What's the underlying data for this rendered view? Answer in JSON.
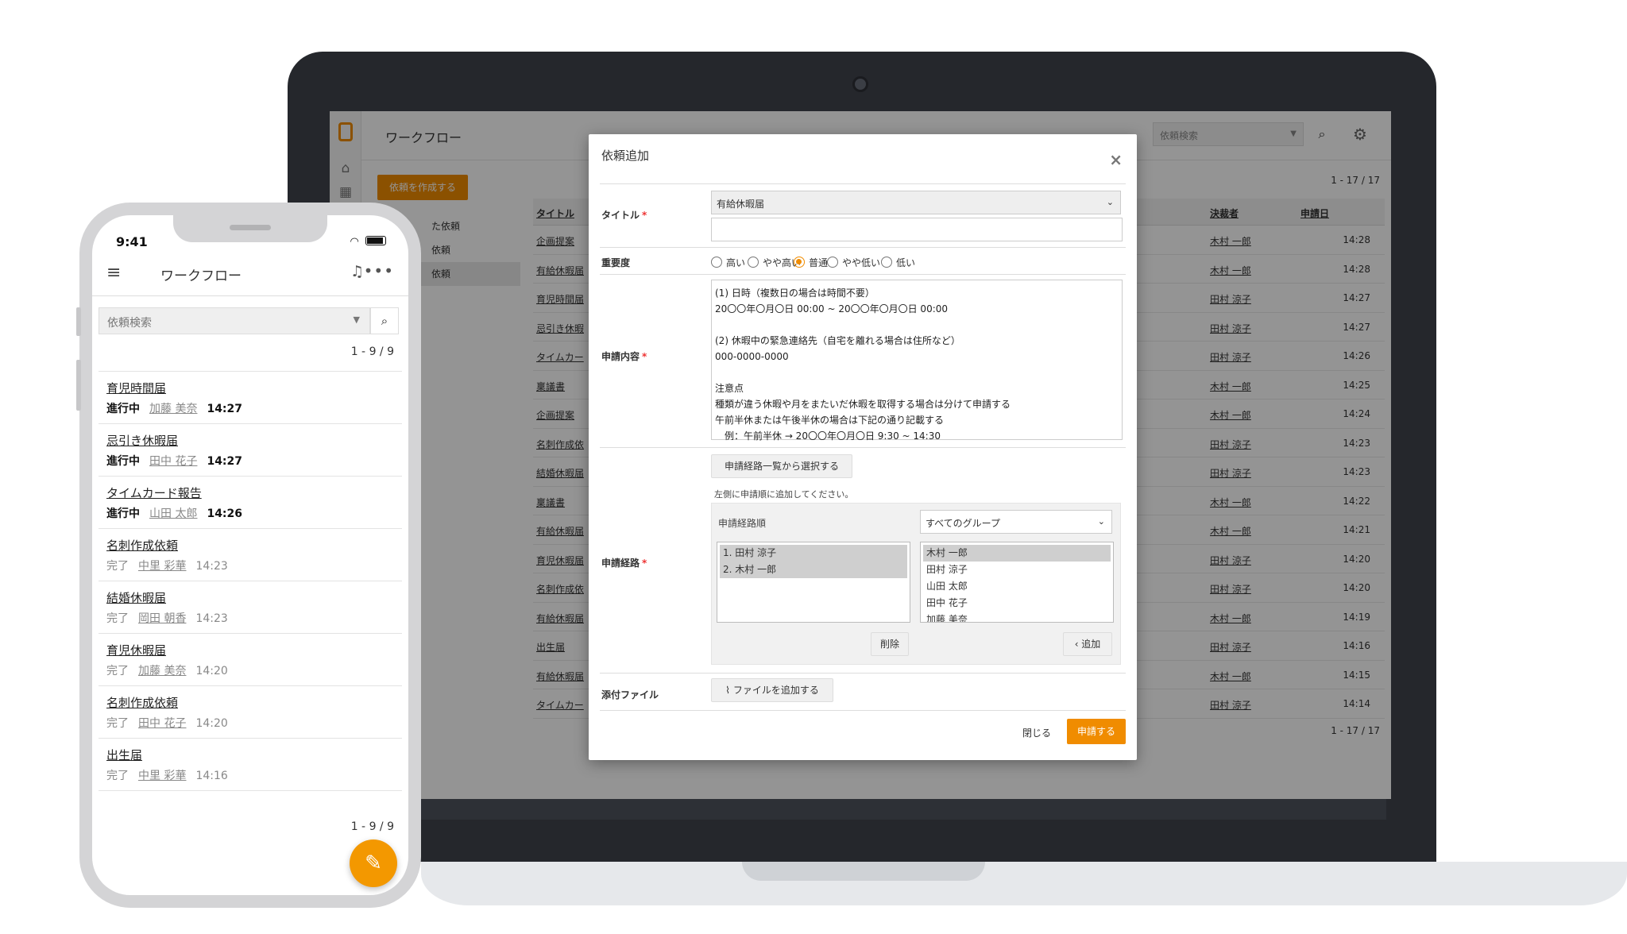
{
  "desktop": {
    "app_title": "ワークフロー",
    "search_placeholder": "依頼検索",
    "create_button": "依頼を作成する",
    "menu": [
      "た依頼",
      "依頼",
      "依頼"
    ],
    "count": "1 - 17 / 17",
    "columns": {
      "title": "タイトル",
      "decider": "決裁者",
      "date": "申請日"
    },
    "rows": [
      {
        "title": "企画提案",
        "decider": "木村 一郎",
        "date": "14:28"
      },
      {
        "title": "有給休暇届",
        "decider": "木村 一郎",
        "date": "14:28"
      },
      {
        "title": "育児時間届",
        "decider": "田村 涼子",
        "date": "14:27"
      },
      {
        "title": "忌引き休暇",
        "decider": "田村 涼子",
        "date": "14:27"
      },
      {
        "title": "タイムカー",
        "decider": "田村 涼子",
        "date": "14:26"
      },
      {
        "title": "稟議書",
        "decider": "木村 一郎",
        "date": "14:25"
      },
      {
        "title": "企画提案",
        "decider": "木村 一郎",
        "date": "14:24"
      },
      {
        "title": "名刺作成依",
        "decider": "田村 涼子",
        "date": "14:23"
      },
      {
        "title": "結婚休暇届",
        "decider": "田村 涼子",
        "date": "14:23"
      },
      {
        "title": "稟議書",
        "decider": "木村 一郎",
        "date": "14:22"
      },
      {
        "title": "有給休暇届",
        "decider": "木村 一郎",
        "date": "14:21"
      },
      {
        "title": "育児休暇届",
        "decider": "田村 涼子",
        "date": "14:20"
      },
      {
        "title": "名刺作成依",
        "decider": "田村 涼子",
        "date": "14:20"
      },
      {
        "title": "有給休暇届",
        "decider": "木村 一郎",
        "date": "14:19"
      },
      {
        "title": "出生届",
        "decider": "田村 涼子",
        "date": "14:16"
      },
      {
        "title": "有給休暇届",
        "decider": "木村 一郎",
        "date": "14:15"
      },
      {
        "title": "タイムカー",
        "decider": "田村 涼子",
        "date": "14:14"
      }
    ]
  },
  "modal": {
    "title": "依頼追加",
    "close_icon": "×",
    "label_title": "タイトル",
    "title_select": "有給休暇届",
    "label_priority": "重要度",
    "priority_options": [
      "高い",
      "やや高い",
      "普通",
      "やや低い",
      "低い"
    ],
    "priority_selected": "普通",
    "label_content": "申請内容",
    "content_lines": [
      "(1) 日時（複数日の場合は時間不要）",
      "20〇〇年〇月〇日 00:00 ~ 20〇〇年〇月〇日 00:00",
      "",
      "(2) 休暇中の緊急連絡先（自宅を離れる場合は住所など）",
      "000-0000-0000",
      "",
      "注意点",
      "種類が違う休暇や月をまたいだ休暇を取得する場合は分けて申請する",
      "午前半休または午後半休の場合は下記の通り記載する",
      "　例：午前半休 → 20〇〇年〇月〇日 9:30 ~ 14:30"
    ],
    "label_route": "申請経路",
    "route_select_button": "申請経路一覧から選択する",
    "route_hint": "左側に申請順に追加してください。",
    "route_order_label": "申請経路順",
    "group_select": "すべてのグループ",
    "route_order": [
      "1. 田村 涼子",
      "2. 木村 一郎"
    ],
    "members": [
      "木村 一郎",
      "田村 涼子",
      "山田 太郎",
      "田中 花子",
      "加藤 美奈"
    ],
    "delete_button": "削除",
    "add_button": "‹ 追加",
    "label_attachment": "添付ファイル",
    "attach_button": "ファイルを追加する",
    "close_link": "閉じる",
    "submit_button": "申請する"
  },
  "phone": {
    "time": "9:41",
    "app_title": "ワークフロー",
    "search_placeholder": "依頼検索",
    "count": "1 - 9 / 9",
    "items": [
      {
        "title": "育児時間届",
        "status": "進行中",
        "person": "加藤 美奈",
        "time": "14:27",
        "active": true
      },
      {
        "title": "忌引き休暇届",
        "status": "進行中",
        "person": "田中 花子",
        "time": "14:27",
        "active": true
      },
      {
        "title": "タイムカード報告",
        "status": "進行中",
        "person": "山田 太郎",
        "time": "14:26",
        "active": true
      },
      {
        "title": "名刺作成依頼",
        "status": "完了",
        "person": "中里 彩華",
        "time": "14:23",
        "active": false
      },
      {
        "title": "結婚休暇届",
        "status": "完了",
        "person": "岡田 朝香",
        "time": "14:23",
        "active": false
      },
      {
        "title": "育児休暇届",
        "status": "完了",
        "person": "加藤 美奈",
        "time": "14:20",
        "active": false
      },
      {
        "title": "名刺作成依頼",
        "status": "完了",
        "person": "田中 花子",
        "time": "14:20",
        "active": false
      },
      {
        "title": "出生届",
        "status": "完了",
        "person": "中里 彩華",
        "time": "14:16",
        "active": false
      }
    ]
  },
  "colors": {
    "accent": "#f08c00",
    "fab": "#f39800"
  }
}
